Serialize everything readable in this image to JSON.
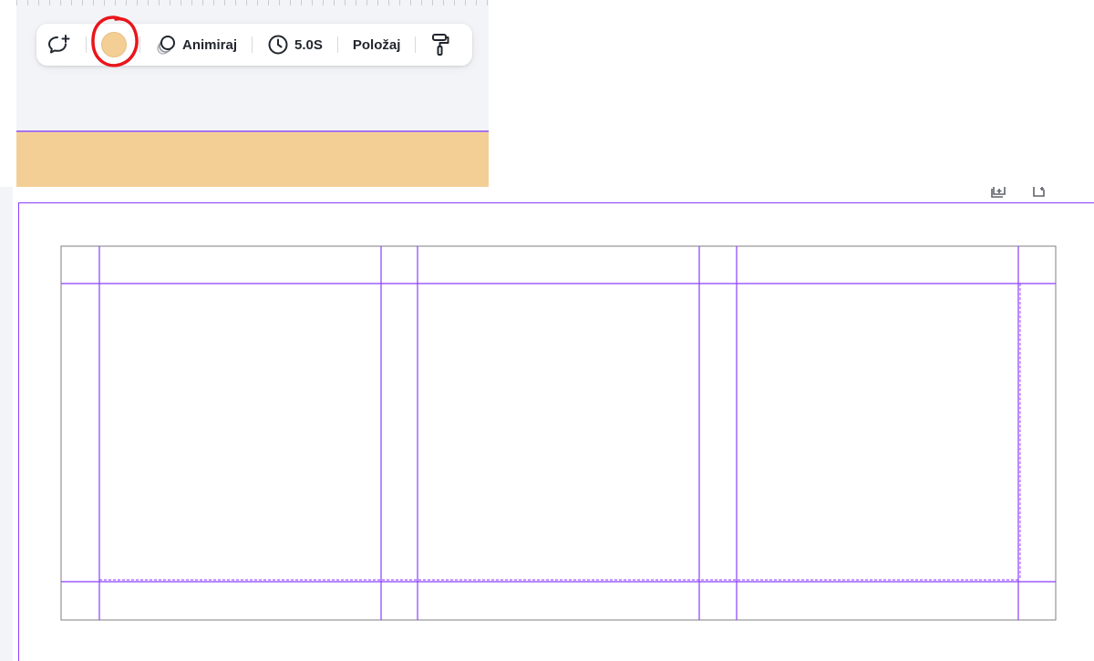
{
  "toolbar": {
    "color_swatch": "#f3cf96",
    "animate_label": "Animiraj",
    "duration_label": "5.0S",
    "position_label": "Položaj",
    "icons": [
      "comment-add-icon",
      "animate-icon",
      "clock-icon",
      "paint-roller-icon"
    ]
  },
  "colors": {
    "accent": "#8b3dff",
    "annotation": "#e8161b",
    "page_fill": "#f3cf96",
    "grid_outer": "#7f7f86"
  },
  "grid": {
    "columns": 3,
    "rows": 1
  }
}
